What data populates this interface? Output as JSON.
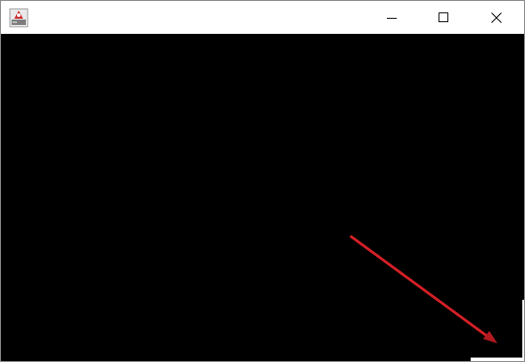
{
  "window": {
    "title": "",
    "app_icon": "java-app-icon",
    "controls": {
      "minimize_icon": "minimize-icon",
      "maximize_icon": "maximize-icon",
      "close_icon": "close-icon"
    }
  },
  "canvas": {
    "background_color": "#000000",
    "arrow": {
      "color": "#d31f26",
      "head_color": "#b01a20"
    }
  }
}
